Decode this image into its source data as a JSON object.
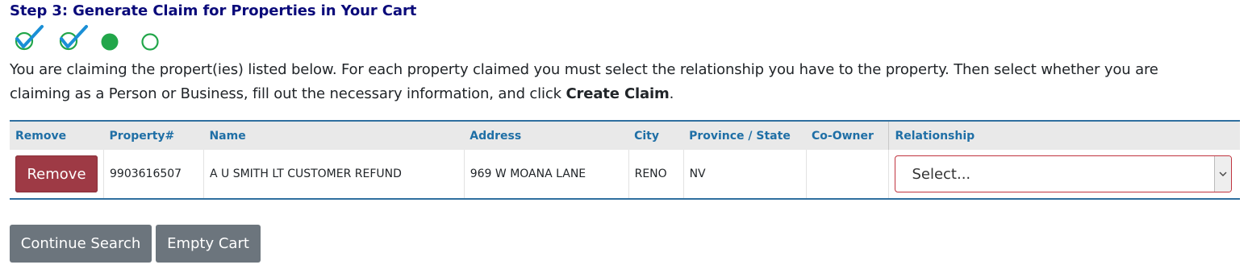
{
  "step": {
    "title": "Step 3: Generate Claim for Properties in Your Cart",
    "progress": [
      {
        "state": "complete",
        "icon": "check-icon"
      },
      {
        "state": "complete",
        "icon": "check-icon"
      },
      {
        "state": "current",
        "icon": "filled-circle-icon"
      },
      {
        "state": "pending",
        "icon": "empty-circle-icon"
      }
    ],
    "colors": {
      "check": "#1a8fd6",
      "circle_green": "#22a64a",
      "title": "#0a0a7a"
    }
  },
  "instructions": {
    "text_before": "You are claiming the propert(ies) listed below. For each property claimed you must select the relationship you have to the property. Then select whether you are claiming as a Person or Business, fill out the necessary information, and click ",
    "bold": "Create Claim",
    "text_after": "."
  },
  "table": {
    "headers": {
      "remove": "Remove",
      "property": "Property#",
      "name": "Name",
      "address": "Address",
      "city": "City",
      "province": "Province / State",
      "coowner": "Co-Owner",
      "relationship": "Relationship"
    },
    "rows": [
      {
        "remove_label": "Remove",
        "property": "9903616507",
        "name": "A U SMITH LT CUSTOMER REFUND",
        "address": "969 W MOANA LANE",
        "city": "RENO",
        "province": "NV",
        "coowner": "",
        "relationship_selected": "Select..."
      }
    ]
  },
  "actions": {
    "continue_label": "Continue Search",
    "empty_label": "Empty Cart"
  }
}
